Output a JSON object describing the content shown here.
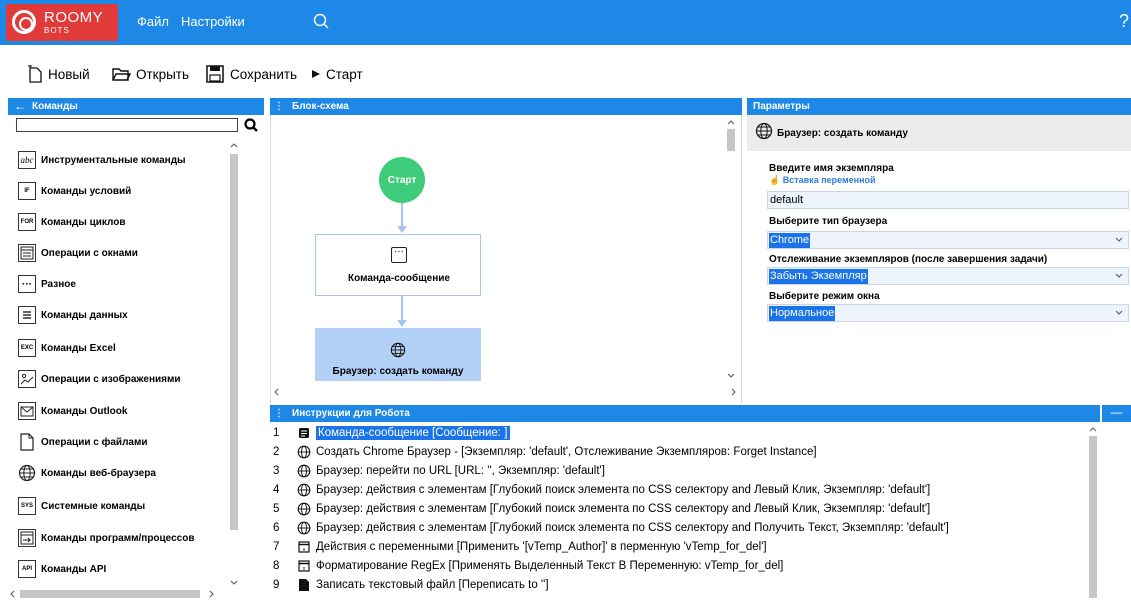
{
  "topbar": {
    "logo_brand": "ROOMY",
    "logo_sub": "BOTS",
    "menu": [
      "Файл",
      "Настройки"
    ],
    "help": "?"
  },
  "toolbar": {
    "new_label": "Новый",
    "open_label": "Открыть",
    "save_label": "Сохранить",
    "start_label": "Старт"
  },
  "commands": {
    "header": "Команды",
    "search_value": "",
    "items": [
      {
        "icon": "abc",
        "label": "Инструментальные команды"
      },
      {
        "icon": "IF",
        "label": "Команды условий"
      },
      {
        "icon": "FOR",
        "label": "Команды циклов"
      },
      {
        "icon": "window",
        "label": "Операции с окнами"
      },
      {
        "icon": "...",
        "label": "Разное"
      },
      {
        "icon": "data",
        "label": "Команды данных"
      },
      {
        "icon": "EXC",
        "label": "Команды Excel"
      },
      {
        "icon": "image",
        "label": "Операции с изображениями"
      },
      {
        "icon": "mail",
        "label": "Команды Outlook"
      },
      {
        "icon": "file",
        "label": "Операции с файлами"
      },
      {
        "icon": "globe",
        "label": "Команды веб-браузера"
      },
      {
        "icon": "SYS",
        "label": "Системные команды"
      },
      {
        "icon": "program",
        "label": "Команды программ/процессов"
      },
      {
        "icon": "API",
        "label": "Команды API"
      }
    ]
  },
  "flow": {
    "header": "Блок-схема",
    "start_label": "Старт",
    "node1_label": "Команда-сообщение",
    "node2_label": "Браузер: создать команду"
  },
  "params": {
    "header": "Параметры",
    "title": "Браузер: создать команду",
    "instance_label": "Введите имя экземпляра",
    "insert_var": "Вставка переменной",
    "instance_value": "default",
    "browser_label": "Выберите тип браузера",
    "browser_value": "Chrome",
    "tracking_label": "Отслеживание экземпляров (после завершения задачи)",
    "tracking_value": "Забыть Экземпляр",
    "window_label": "Выберите режим окна",
    "window_value": "Нормальное"
  },
  "instructions": {
    "header": "Инструкции для Робота",
    "rows": [
      {
        "num": "1",
        "icon": "message",
        "text": "Команда-сообщение [Сообщение: ]",
        "selected": true
      },
      {
        "num": "2",
        "icon": "globe",
        "text": "Создать Chrome Браузер - [Экземпляр: 'default', Отслеживание Экземпляров: Forget Instance]"
      },
      {
        "num": "3",
        "icon": "globe",
        "text": "Браузер: перейти по URL [URL: '', Экземпляр: 'default']"
      },
      {
        "num": "4",
        "icon": "globe",
        "text": "Браузер: действия с элементам [Глубокий поиск элемента по CSS селектору and Левый Клик, Экземпляр: 'default']"
      },
      {
        "num": "5",
        "icon": "globe",
        "text": "Браузер: действия с элементам [Глубокий поиск элемента по CSS селектору and Левый Клик, Экземпляр: 'default']"
      },
      {
        "num": "6",
        "icon": "globe",
        "text": "Браузер: действия с элементам [Глубокий поиск элемента по CSS селектору and Получить Текст, Экземпляр: 'default']"
      },
      {
        "num": "7",
        "icon": "variable",
        "text": "Действия с переменными [Применить '[vTemp_Author]' в перменную 'vTemp_for_del']"
      },
      {
        "num": "8",
        "icon": "variable",
        "text": "Форматирование RegEx [Применять Выделенный Текст В Переменную: vTemp_for_del]"
      },
      {
        "num": "9",
        "icon": "file",
        "text": "Записать текстовый файл [Переписать to '']"
      }
    ]
  },
  "colors": {
    "accent": "#1d88e5",
    "selected": "#1a73e8",
    "start_node": "#3ecb7a",
    "logo": "#e03a3a"
  }
}
